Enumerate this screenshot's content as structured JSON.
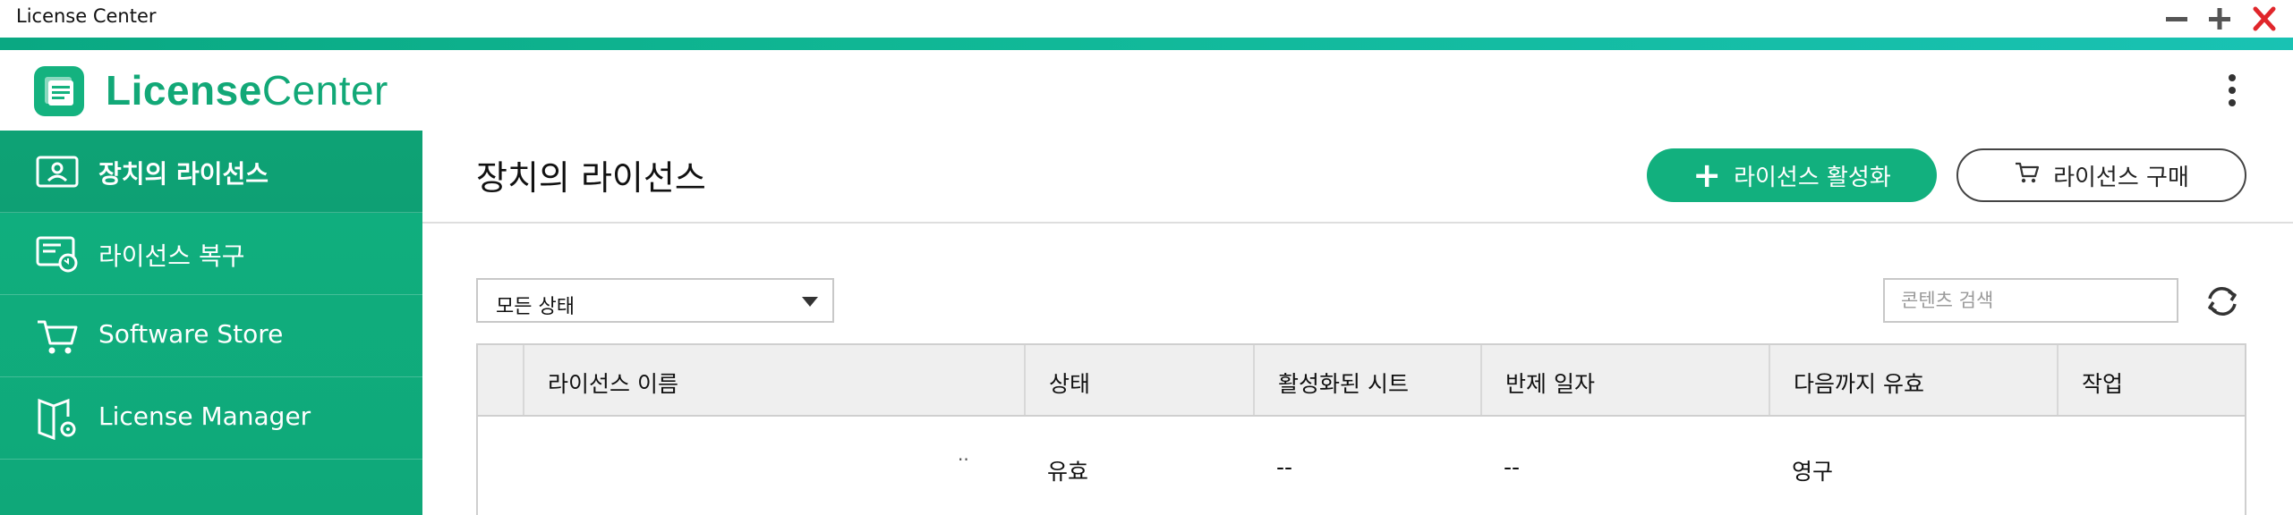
{
  "window": {
    "title": "License Center",
    "controls": [
      "minimize",
      "maximize",
      "close"
    ],
    "close_color": "#e0262b"
  },
  "header": {
    "logo_bold": "License",
    "logo_light": "Center",
    "brand_color": "#12a877",
    "menu_icon": "kebab-menu-icon"
  },
  "sidebar": {
    "items": [
      {
        "label": "장치의 라이선스",
        "icon": "device-license-icon",
        "active": true
      },
      {
        "label": "라이선스 복구",
        "icon": "license-restore-icon",
        "active": false
      },
      {
        "label": "Software Store",
        "icon": "cart-icon",
        "active": false
      },
      {
        "label": "License Manager",
        "icon": "license-manager-icon",
        "active": false
      }
    ]
  },
  "main": {
    "page_title": "장치의 라이선스",
    "activate_button": "라이선스 활성화",
    "buy_button": "라이선스 구매",
    "filter_value": "모든 상태",
    "search_placeholder": "콘텐츠 검색",
    "table": {
      "columns": [
        "라이선스 이름",
        "상태",
        "활성화된 시트",
        "반제 일자",
        "다음까지 유효",
        "작업"
      ],
      "rows": [
        {
          "name_suffix": "··",
          "status": "유효",
          "seats": "--",
          "refund_date": "--",
          "valid_until": "영구",
          "action": ""
        }
      ]
    }
  }
}
